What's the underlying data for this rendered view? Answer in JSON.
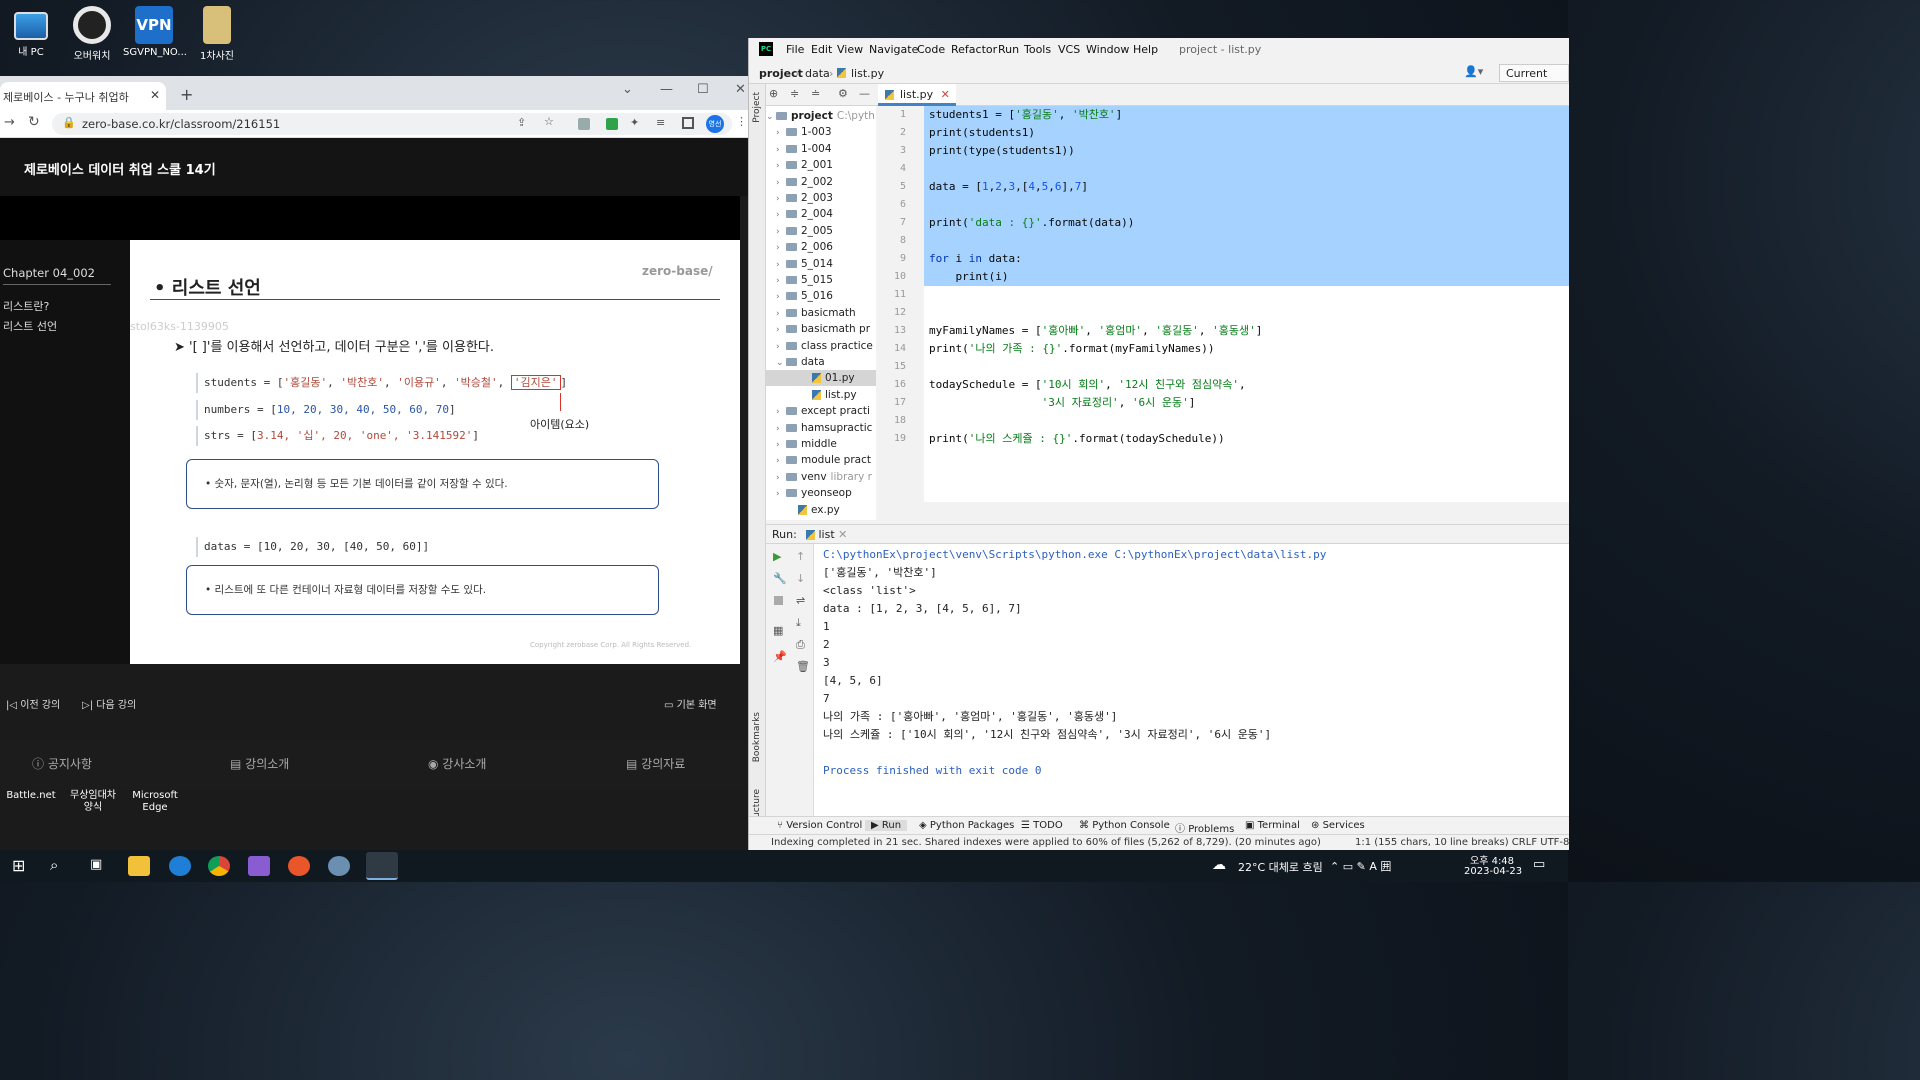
{
  "desktop": {
    "icons": [
      {
        "label": "내 PC"
      },
      {
        "label": "오버워치"
      },
      {
        "label": "SGVPN_NO..."
      },
      {
        "label": "1차사진"
      }
    ],
    "bottom_icons": [
      {
        "label": "Battle.net"
      },
      {
        "label": "무상임대차\n양식"
      },
      {
        "label": "Microsoft\nEdge"
      }
    ]
  },
  "browser": {
    "tab_title": "제로베이스 - 누구나 취업하",
    "url": "zero-base.co.kr/classroom/216151",
    "profile_badge": "영선",
    "course_title": "제로베이스 데이터 취업 스쿨 14기",
    "left_panel": {
      "chapter": "Chapter  04_002",
      "items": [
        "리스트란?",
        "리스트 선언"
      ]
    },
    "slide": {
      "brand": "zero-base/",
      "heading": "• 리스트 선언",
      "watermark": "stol63ks-1139905",
      "bullet": "'[ ]'를 이용해서 선언하고, 데이터 구분은 ','를 이용한다.",
      "code1": {
        "prefix": "students = [",
        "items": [
          "'홍길동'",
          "'박찬호'",
          "'이용규'",
          "'박승철'"
        ],
        "highlight": "'김지은'",
        "suffix": "]"
      },
      "code2": {
        "prefix": "numbers = [",
        "values": "10, 20, 30, 40, 50, 60, 70",
        "suffix": "]"
      },
      "code3": {
        "prefix": "strs = [",
        "values": "3.14, '십', 20, 'one', '3.141592'",
        "suffix": "]"
      },
      "item_label": "아이템(요소)",
      "note1": "숫자, 문자(열), 논리형 등 모든 기본 데이터를 같이 저장할 수 있다.",
      "code4": "datas = [10, 20, 30, [40, 50, 60]]",
      "note2": "리스트에 또 다른 컨테이너 자료형 데이터를 저장할 수도 있다.",
      "copyright": "Copyright zerobase Corp. All Rights Reserved."
    },
    "controls": {
      "prev": "이전 강의",
      "next": "다음 강의",
      "view": "기본 화면"
    },
    "bottom_nav": [
      "공지사항",
      "강의소개",
      "강사소개",
      "강의자료"
    ]
  },
  "ide": {
    "menu": [
      "File",
      "Edit",
      "View",
      "Navigate",
      "Code",
      "Refactor",
      "Run",
      "Tools",
      "VCS",
      "Window",
      "Help"
    ],
    "window_title": "project - list.py",
    "breadcrumb": [
      "project",
      "data",
      "list.py"
    ],
    "run_config": "Current File",
    "project_label": "Project",
    "tree": [
      {
        "label": "project",
        "extra": "C:\\pyth",
        "type": "root"
      },
      {
        "label": "1-003",
        "type": "folder"
      },
      {
        "label": "1-004",
        "type": "folder"
      },
      {
        "label": "2_001",
        "type": "folder"
      },
      {
        "label": "2_002",
        "type": "folder"
      },
      {
        "label": "2_003",
        "type": "folder"
      },
      {
        "label": "2_004",
        "type": "folder"
      },
      {
        "label": "2_005",
        "type": "folder"
      },
      {
        "label": "2_006",
        "type": "folder"
      },
      {
        "label": "5_014",
        "type": "folder"
      },
      {
        "label": "5_015",
        "type": "folder"
      },
      {
        "label": "5_016",
        "type": "folder"
      },
      {
        "label": "basicmath",
        "type": "folder"
      },
      {
        "label": "basicmath pr",
        "type": "folder"
      },
      {
        "label": "class practice",
        "type": "folder"
      },
      {
        "label": "data",
        "type": "folder-open"
      },
      {
        "label": "01.py",
        "type": "file"
      },
      {
        "label": "list.py",
        "type": "file"
      },
      {
        "label": "except practi",
        "type": "folder"
      },
      {
        "label": "hamsupractic",
        "type": "folder"
      },
      {
        "label": "middle",
        "type": "folder"
      },
      {
        "label": "module pract",
        "type": "folder"
      },
      {
        "label": "venv",
        "extra": "library r",
        "type": "folder"
      },
      {
        "label": "yeonseop",
        "type": "folder"
      },
      {
        "label": "ex.py",
        "type": "file-root"
      }
    ],
    "editor_tab": "list.py",
    "code_lines": [
      "students1 = ['홍길동', '박찬호']",
      "print(students1)",
      "print(type(students1))",
      "",
      "data = [1,2,3,[4,5,6],7]",
      "",
      "print('data : {}'.format(data))",
      "",
      "for i in data:",
      "    print(i)",
      "",
      "",
      "myFamilyNames = ['홍아빠', '홍엄마', '홍길동', '홍동생']",
      "print('나의 가족 : {}'.format(myFamilyNames))",
      "",
      "todaySchedule = ['10시 회의', '12시 친구와 점심약속',",
      "                 '3시 자료정리', '6시 운동']",
      "",
      "print('나의 스케쥴 : {}'.format(todaySchedule))"
    ],
    "run_label": "Run:",
    "run_tab": "list",
    "console_lines": [
      "C:\\pythonEx\\project\\venv\\Scripts\\python.exe C:\\pythonEx\\project\\data\\list.py",
      "['홍길동', '박찬호']",
      "<class 'list'>",
      "data : [1, 2, 3, [4, 5, 6], 7]",
      "1",
      "2",
      "3",
      "[4, 5, 6]",
      "7",
      "나의 가족 : ['홍아빠', '홍엄마', '홍길동', '홍동생']",
      "나의 스케쥴 : ['10시 회의', '12시 친구와 점심약속', '3시 자료정리', '6시 운동']",
      "",
      "Process finished with exit code 0"
    ],
    "bottom_tabs": [
      "Version Control",
      "Run",
      "Python Packages",
      "TODO",
      "Python Console",
      "Problems",
      "Terminal",
      "Services"
    ],
    "status_left": "Indexing completed in 21 sec. Shared indexes were applied to 60% of files (5,262 of 8,729). (20 minutes ago)",
    "status_right": "1:1 (155 chars, 10 line breaks)  CRLF  UTF-8",
    "side_labels": [
      "Bookmarks",
      "Structure"
    ]
  },
  "taskbar": {
    "weather": "22°C  대체로 흐림",
    "time": "오후 4:48",
    "date": "2023-04-23"
  },
  "colors": {
    "ide_selection": "#a6d2ff",
    "keyword": "#0033b3",
    "string": "#067d17",
    "number": "#1750eb",
    "slide_border": "#2d4f8b",
    "highlight_box": "#d9312a"
  }
}
